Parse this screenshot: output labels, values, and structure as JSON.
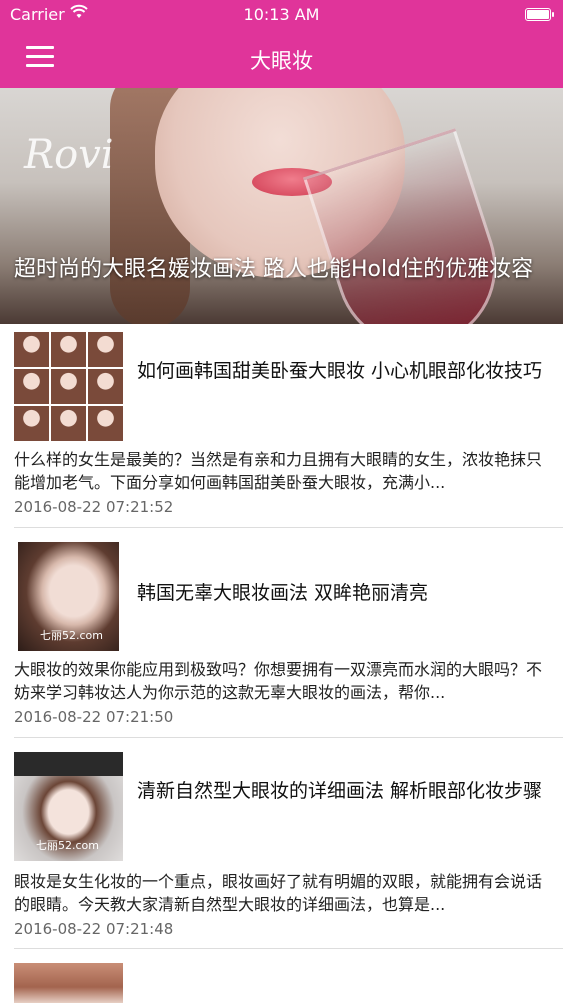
{
  "status": {
    "carrier": "Carrier",
    "time": "10:13 AM"
  },
  "nav": {
    "title": "大眼妆"
  },
  "hero": {
    "logo": "Rovi",
    "caption": "超时尚的大眼名媛妆画法 路人也能Hold住的优雅妆容"
  },
  "articles": [
    {
      "title": "如何画韩国甜美卧蚕大眼妆 小心机眼部化妆技巧",
      "summary": "什么样的女生是最美的？当然是有亲和力且拥有大眼睛的女生，浓妆艳抹只能增加老气。下面分享如何画韩国甜美卧蚕大眼妆，充满小...",
      "date": "2016-08-22 07:21:52",
      "watermark": ""
    },
    {
      "title": "韩国无辜大眼妆画法 双眸艳丽清亮",
      "summary": "大眼妆的效果你能应用到极致吗？你想要拥有一双漂亮而水润的大眼吗？不妨来学习韩妆达人为你示范的这款无辜大眼妆的画法，帮你...",
      "date": "2016-08-22 07:21:50",
      "watermark": "七丽52.com"
    },
    {
      "title": "清新自然型大眼妆的详细画法 解析眼部化妆步骤",
      "summary": "眼妆是女生化妆的一个重点，眼妆画好了就有明媚的双眼，就能拥有会说话的眼睛。今天教大家清新自然型大眼妆的详细画法，也算是...",
      "date": "2016-08-22 07:21:48",
      "watermark": "七丽52.com"
    }
  ],
  "colors": {
    "accent": "#E0349A"
  }
}
